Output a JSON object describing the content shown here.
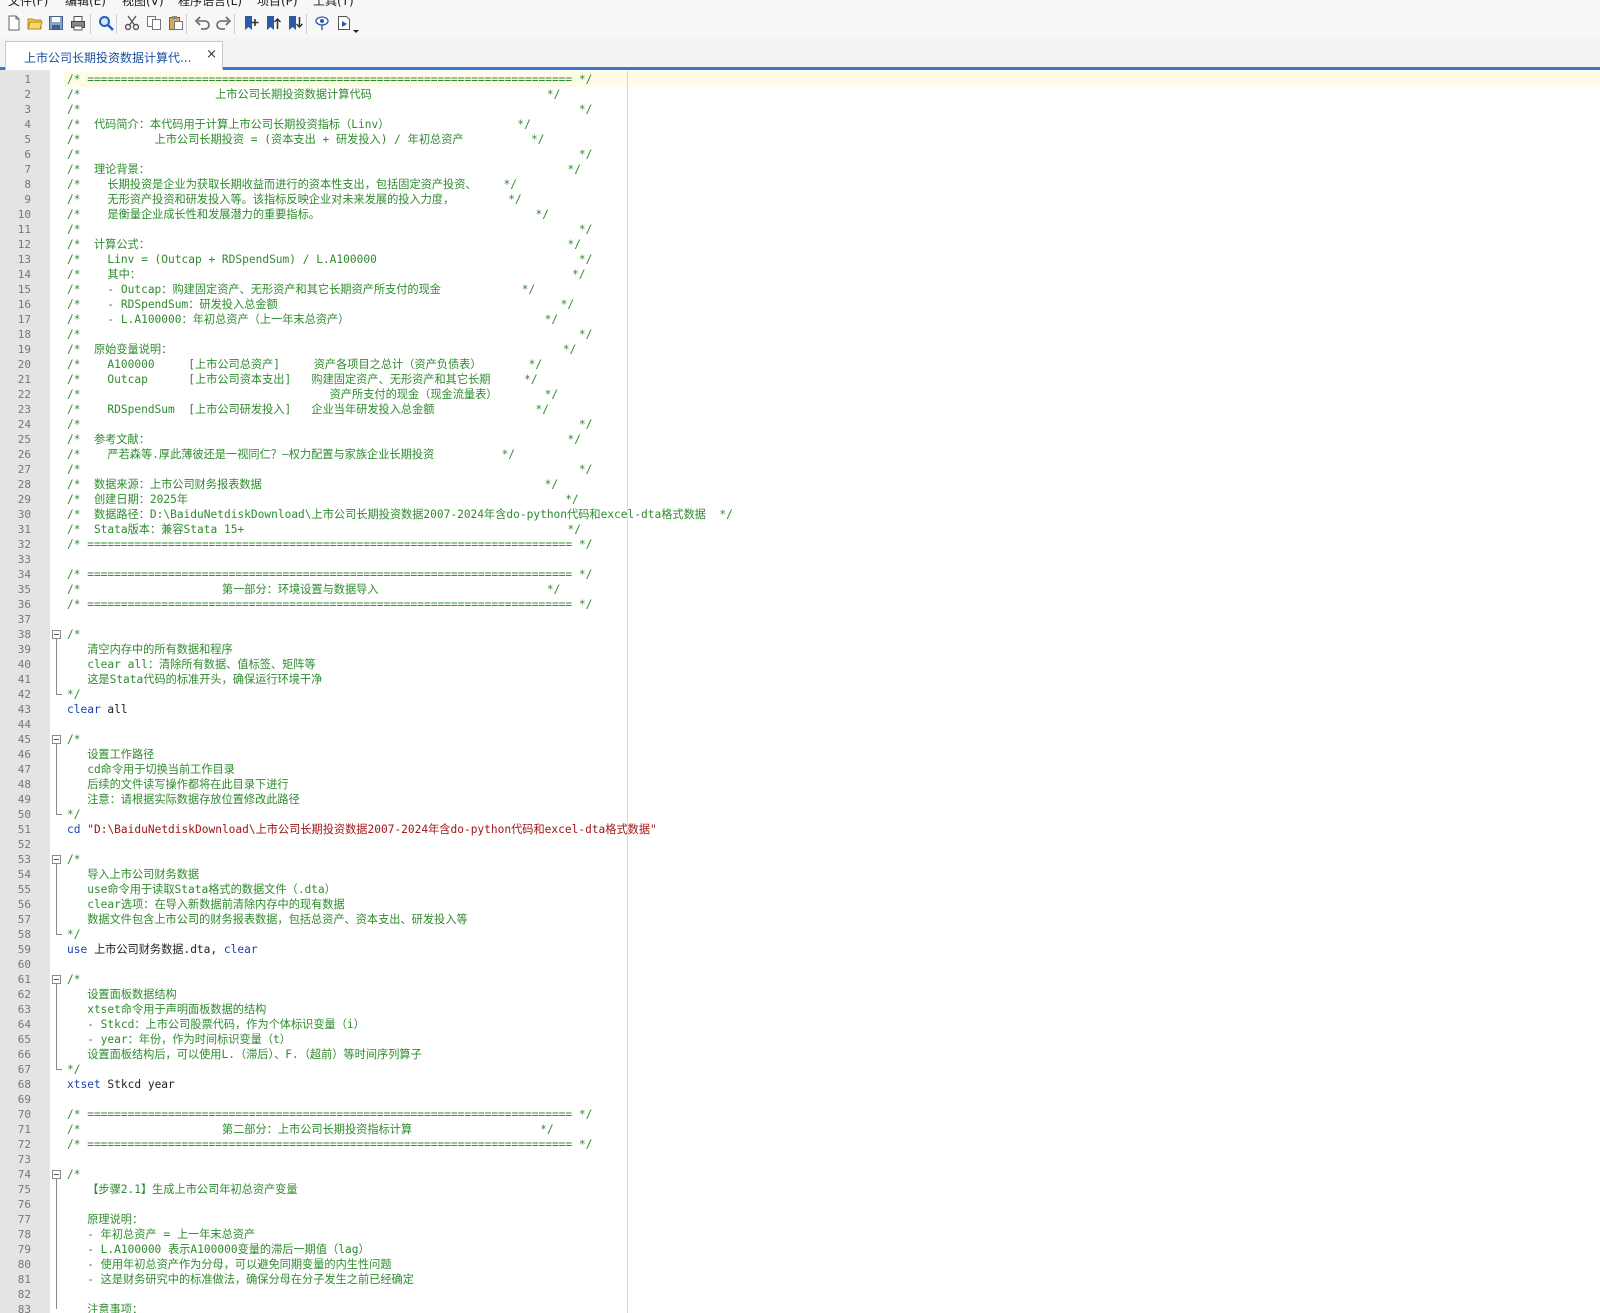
{
  "menubar": {
    "items": [
      "文件(F)",
      "编辑(E)",
      "视图(V)",
      "程序语言(L)",
      "项目(P)",
      "工具(T)"
    ]
  },
  "toolbar": {
    "buttons": [
      "new-file-icon",
      "open-file-icon",
      "save-icon",
      "print-icon",
      "find-icon",
      "cut-icon",
      "copy-icon",
      "paste-icon",
      "undo-icon",
      "redo-icon",
      "toggle-bookmark-icon",
      "previous-bookmark-icon",
      "next-bookmark-icon",
      "show-icon",
      "run-icon",
      "dropdown-arrow-icon"
    ]
  },
  "tab": {
    "title": "上市公司长期投资数据计算代...",
    "close": "×"
  },
  "colors": {
    "comment": "#2e8b2e",
    "keyword": "#1a3fb3",
    "string": "#a31515",
    "tab_accent": "#3a78c9",
    "gutter": "#e4e4e4"
  },
  "editor": {
    "lines": [
      {
        "n": "1",
        "t": "/* ======================================================================== */",
        "c": "cmt"
      },
      {
        "n": "2",
        "t": "/*                    上市公司长期投资数据计算代码                          */",
        "c": "cmt"
      },
      {
        "n": "3",
        "t": "/*                                                                          */",
        "c": "cmt"
      },
      {
        "n": "4",
        "t": "/*  代码简介：本代码用于计算上市公司长期投资指标（Linv）                   */",
        "c": "cmt"
      },
      {
        "n": "5",
        "t": "/*           上市公司长期投资 = (资本支出 + 研发投入) / 年初总资产          */",
        "c": "cmt"
      },
      {
        "n": "6",
        "t": "/*                                                                          */",
        "c": "cmt"
      },
      {
        "n": "7",
        "t": "/*  理论背景：                                                              */",
        "c": "cmt"
      },
      {
        "n": "8",
        "t": "/*    长期投资是企业为获取长期收益而进行的资本性支出，包括固定资产投资、    */",
        "c": "cmt"
      },
      {
        "n": "9",
        "t": "/*    无形资产投资和研发投入等。该指标反映企业对未来发展的投入力度，        */",
        "c": "cmt"
      },
      {
        "n": "10",
        "t": "/*    是衡量企业成长性和发展潜力的重要指标。                                */",
        "c": "cmt"
      },
      {
        "n": "11",
        "t": "/*                                                                          */",
        "c": "cmt"
      },
      {
        "n": "12",
        "t": "/*  计算公式：                                                              */",
        "c": "cmt"
      },
      {
        "n": "13",
        "t": "/*    Linv = (Outcap + RDSpendSum) / L.A100000                              */",
        "c": "cmt"
      },
      {
        "n": "14",
        "t": "/*    其中：                                                                */",
        "c": "cmt"
      },
      {
        "n": "15",
        "t": "/*    - Outcap：购建固定资产、无形资产和其它长期资产所支付的现金            */",
        "c": "cmt"
      },
      {
        "n": "16",
        "t": "/*    - RDSpendSum：研发投入总金额                                          */",
        "c": "cmt"
      },
      {
        "n": "17",
        "t": "/*    - L.A100000：年初总资产（上一年末总资产）                             */",
        "c": "cmt"
      },
      {
        "n": "18",
        "t": "/*                                                                          */",
        "c": "cmt"
      },
      {
        "n": "19",
        "t": "/*  原始变量说明：                                                          */",
        "c": "cmt"
      },
      {
        "n": "20",
        "t": "/*    A100000     [上市公司总资产]     资产各项目之总计（资产负债表）       */",
        "c": "cmt"
      },
      {
        "n": "21",
        "t": "/*    Outcap      [上市公司资本支出]   购建固定资产、无形资产和其它长期     */",
        "c": "cmt"
      },
      {
        "n": "22",
        "t": "/*                                     资产所支付的现金（现金流量表）       */",
        "c": "cmt"
      },
      {
        "n": "23",
        "t": "/*    RDSpendSum  [上市公司研发投入]   企业当年研发投入总金额               */",
        "c": "cmt"
      },
      {
        "n": "24",
        "t": "/*                                                                          */",
        "c": "cmt"
      },
      {
        "n": "25",
        "t": "/*  参考文献：                                                              */",
        "c": "cmt"
      },
      {
        "n": "26",
        "t": "/*    严若森等.厚此薄彼还是一视同仁？—权力配置与家族企业长期投资          */",
        "c": "cmt"
      },
      {
        "n": "27",
        "t": "/*                                                                          */",
        "c": "cmt"
      },
      {
        "n": "28",
        "t": "/*  数据来源：上市公司财务报表数据                                          */",
        "c": "cmt"
      },
      {
        "n": "29",
        "t": "/*  创建日期：2025年                                                        */",
        "c": "cmt"
      },
      {
        "n": "30",
        "t": "/*  数据路径：D:\\BaiduNetdiskDownload\\上市公司长期投资数据2007-2024年含do-python代码和excel-dta格式数据  */",
        "c": "cmt"
      },
      {
        "n": "31",
        "t": "/*  Stata版本：兼容Stata 15+                                                */",
        "c": "cmt"
      },
      {
        "n": "32",
        "t": "/* ======================================================================== */",
        "c": "cmt"
      },
      {
        "n": "33",
        "t": "",
        "c": "cmt"
      },
      {
        "n": "34",
        "t": "/* ======================================================================== */",
        "c": "cmt"
      },
      {
        "n": "35",
        "t": "/*                     第一部分：环境设置与数据导入                         */",
        "c": "cmt"
      },
      {
        "n": "36",
        "t": "/* ======================================================================== */",
        "c": "cmt"
      },
      {
        "n": "37",
        "t": "",
        "c": "cmt"
      },
      {
        "n": "38",
        "t": "/*",
        "c": "cmt"
      },
      {
        "n": "39",
        "t": "   清空内存中的所有数据和程序",
        "c": "cmt"
      },
      {
        "n": "40",
        "t": "   clear all：清除所有数据、值标签、矩阵等",
        "c": "cmt"
      },
      {
        "n": "41",
        "t": "   这是Stata代码的标准开头，确保运行环境干净",
        "c": "cmt"
      },
      {
        "n": "42",
        "t": "*/",
        "c": "cmt"
      },
      {
        "n": "43",
        "t": "",
        "c": "code",
        "parts": [
          {
            "t": "clear",
            "c": "kw"
          },
          {
            "t": " all",
            "c": "plain"
          }
        ]
      },
      {
        "n": "44",
        "t": "",
        "c": "cmt"
      },
      {
        "n": "45",
        "t": "/*",
        "c": "cmt"
      },
      {
        "n": "46",
        "t": "   设置工作路径",
        "c": "cmt"
      },
      {
        "n": "47",
        "t": "   cd命令用于切换当前工作目录",
        "c": "cmt"
      },
      {
        "n": "48",
        "t": "   后续的文件读写操作都将在此目录下进行",
        "c": "cmt"
      },
      {
        "n": "49",
        "t": "   注意：请根据实际数据存放位置修改此路径",
        "c": "cmt"
      },
      {
        "n": "50",
        "t": "*/",
        "c": "cmt"
      },
      {
        "n": "51",
        "t": "",
        "c": "code",
        "parts": [
          {
            "t": "cd",
            "c": "kw"
          },
          {
            "t": " ",
            "c": "plain"
          },
          {
            "t": "\"D:\\BaiduNetdiskDownload\\上市公司长期投资数据2007-2024年含do-python代码和excel-dta格式数据\"",
            "c": "str"
          }
        ]
      },
      {
        "n": "52",
        "t": "",
        "c": "cmt"
      },
      {
        "n": "53",
        "t": "/*",
        "c": "cmt"
      },
      {
        "n": "54",
        "t": "   导入上市公司财务数据",
        "c": "cmt"
      },
      {
        "n": "55",
        "t": "   use命令用于读取Stata格式的数据文件（.dta）",
        "c": "cmt"
      },
      {
        "n": "56",
        "t": "   clear选项：在导入新数据前清除内存中的现有数据",
        "c": "cmt"
      },
      {
        "n": "57",
        "t": "   数据文件包含上市公司的财务报表数据，包括总资产、资本支出、研发投入等",
        "c": "cmt"
      },
      {
        "n": "58",
        "t": "*/",
        "c": "cmt"
      },
      {
        "n": "59",
        "t": "",
        "c": "code",
        "parts": [
          {
            "t": "use",
            "c": "kw"
          },
          {
            "t": " 上市公司财务数据.dta, ",
            "c": "plain"
          },
          {
            "t": "clear",
            "c": "kw"
          }
        ]
      },
      {
        "n": "60",
        "t": "",
        "c": "cmt"
      },
      {
        "n": "61",
        "t": "/*",
        "c": "cmt"
      },
      {
        "n": "62",
        "t": "   设置面板数据结构",
        "c": "cmt"
      },
      {
        "n": "63",
        "t": "   xtset命令用于声明面板数据的结构",
        "c": "cmt"
      },
      {
        "n": "64",
        "t": "   - Stkcd：上市公司股票代码，作为个体标识变量（i）",
        "c": "cmt"
      },
      {
        "n": "65",
        "t": "   - year：年份，作为时间标识变量（t）",
        "c": "cmt"
      },
      {
        "n": "66",
        "t": "   设置面板结构后，可以使用L.（滞后）、F.（超前）等时间序列算子",
        "c": "cmt"
      },
      {
        "n": "67",
        "t": "*/",
        "c": "cmt"
      },
      {
        "n": "68",
        "t": "",
        "c": "code",
        "parts": [
          {
            "t": "xtset",
            "c": "kw"
          },
          {
            "t": " Stkcd year",
            "c": "plain"
          }
        ]
      },
      {
        "n": "69",
        "t": "",
        "c": "cmt"
      },
      {
        "n": "70",
        "t": "/* ======================================================================== */",
        "c": "cmt"
      },
      {
        "n": "71",
        "t": "/*                     第二部分：上市公司长期投资指标计算                   */",
        "c": "cmt"
      },
      {
        "n": "72",
        "t": "/* ======================================================================== */",
        "c": "cmt"
      },
      {
        "n": "73",
        "t": "",
        "c": "cmt"
      },
      {
        "n": "74",
        "t": "/*",
        "c": "cmt"
      },
      {
        "n": "75",
        "t": "   【步骤2.1】生成上市公司年初总资产变量",
        "c": "cmt"
      },
      {
        "n": "76",
        "t": "",
        "c": "cmt"
      },
      {
        "n": "77",
        "t": "   原理说明：",
        "c": "cmt"
      },
      {
        "n": "78",
        "t": "   - 年初总资产 = 上一年末总资产",
        "c": "cmt"
      },
      {
        "n": "79",
        "t": "   - L.A100000 表示A100000变量的滞后一期值（lag）",
        "c": "cmt"
      },
      {
        "n": "80",
        "t": "   - 使用年初总资产作为分母，可以避免同期变量的内生性问题",
        "c": "cmt"
      },
      {
        "n": "81",
        "t": "   - 这是财务研究中的标准做法，确保分母在分子发生之前已经确定",
        "c": "cmt"
      },
      {
        "n": "82",
        "t": "",
        "c": "cmt"
      },
      {
        "n": "83",
        "t": "   注意事项：",
        "c": "cmt"
      }
    ]
  }
}
